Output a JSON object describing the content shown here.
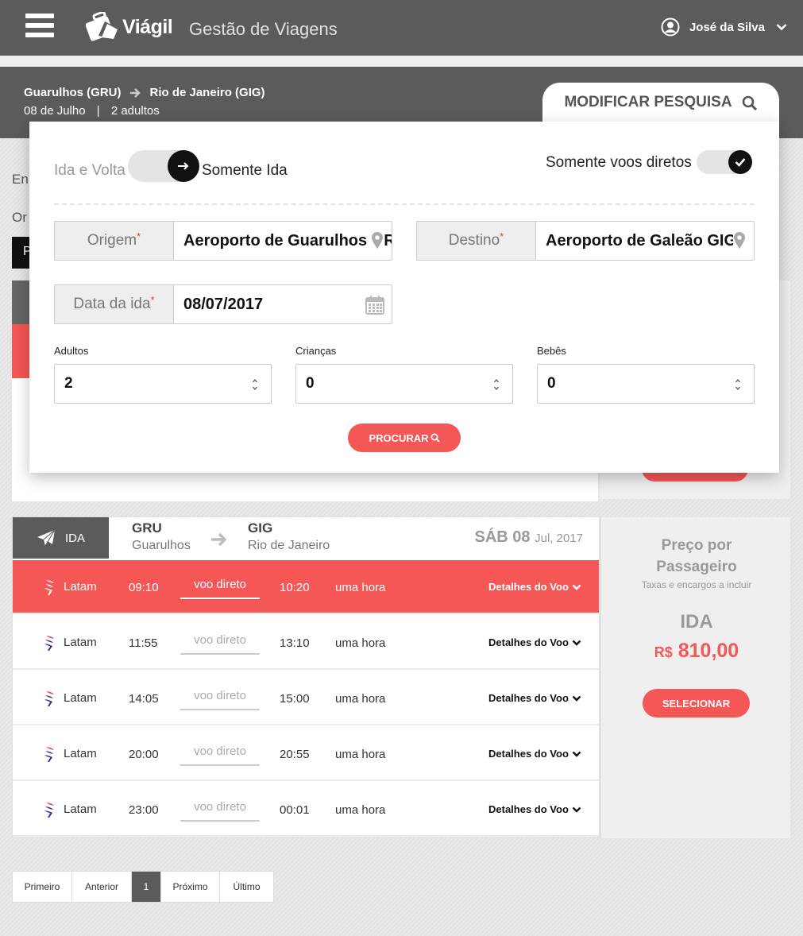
{
  "header": {
    "brand": "Viágil",
    "subtitle": "Gestão de Viagens",
    "user_name": "José da Silva"
  },
  "search_summary": {
    "origin": "Guarulhos (GRU)",
    "destination": "Rio de Janeiro (GIG)",
    "date": "08 de Julho",
    "separator": "|",
    "passengers": "2 adultos",
    "modify_label": "MODIFICAR PESQUISA"
  },
  "background": {
    "text1": "En",
    "text2": "Or",
    "text3": "P"
  },
  "modal": {
    "trip_round_label": "Ida e Volta",
    "trip_oneway_label": "Somente Ida",
    "direct_label": "Somente voos diretos",
    "origin_label": "Origem",
    "origin_value": "Aeroporto de Guarulhos GRU",
    "destination_label": "Destino",
    "destination_value": "Aeroporto de Galeão GIG",
    "date_label": "Data da ida",
    "date_value": "08/07/2017",
    "required_mark": "*",
    "adults_label": "Adultos",
    "adults_value": "2",
    "children_label": "Crianças",
    "children_value": "0",
    "infants_label": "Bebês",
    "infants_value": "0",
    "search_button": "PROCURAR"
  },
  "flight_card": {
    "tab_label": "IDA",
    "from_code": "GRU",
    "from_city": "Guarulhos",
    "to_code": "GIG",
    "to_city": "Rio de Janeiro",
    "date_day": "SÁB 08",
    "date_rest": "Jul, 2017",
    "flights": [
      {
        "airline": "Latam",
        "dep": "09:10",
        "direct": "voo direto",
        "arr": "10:20",
        "duration": "uma hora",
        "details": "Detalhes do Voo"
      },
      {
        "airline": "Latam",
        "dep": "11:55",
        "direct": "voo direto",
        "arr": "13:10",
        "duration": "uma hora",
        "details": "Detalhes do Voo"
      },
      {
        "airline": "Latam",
        "dep": "14:05",
        "direct": "voo direto",
        "arr": "15:00",
        "duration": "uma hora",
        "details": "Detalhes do Voo"
      },
      {
        "airline": "Latam",
        "dep": "20:00",
        "direct": "voo direto",
        "arr": "20:55",
        "duration": "uma hora",
        "details": "Detalhes do Voo"
      },
      {
        "airline": "Latam",
        "dep": "23:00",
        "direct": "voo direto",
        "arr": "00:01",
        "duration": "uma hora",
        "details": "Detalhes do Voo"
      }
    ]
  },
  "price_panel": {
    "title_line1": "Preço por",
    "title_line2": "Passageiro",
    "subtitle": "Taxas e encargos a incluir",
    "leg": "IDA",
    "currency": "R$",
    "amount": "810,00",
    "select_button": "SELECIONAR"
  },
  "pagination": {
    "first": "Primeiro",
    "prev": "Anterior",
    "current": "1",
    "next": "Próximo",
    "last": "Último"
  },
  "colors": {
    "accent": "#f55656",
    "header_bg": "#5b5b5b",
    "panel_bg": "#efefef"
  }
}
